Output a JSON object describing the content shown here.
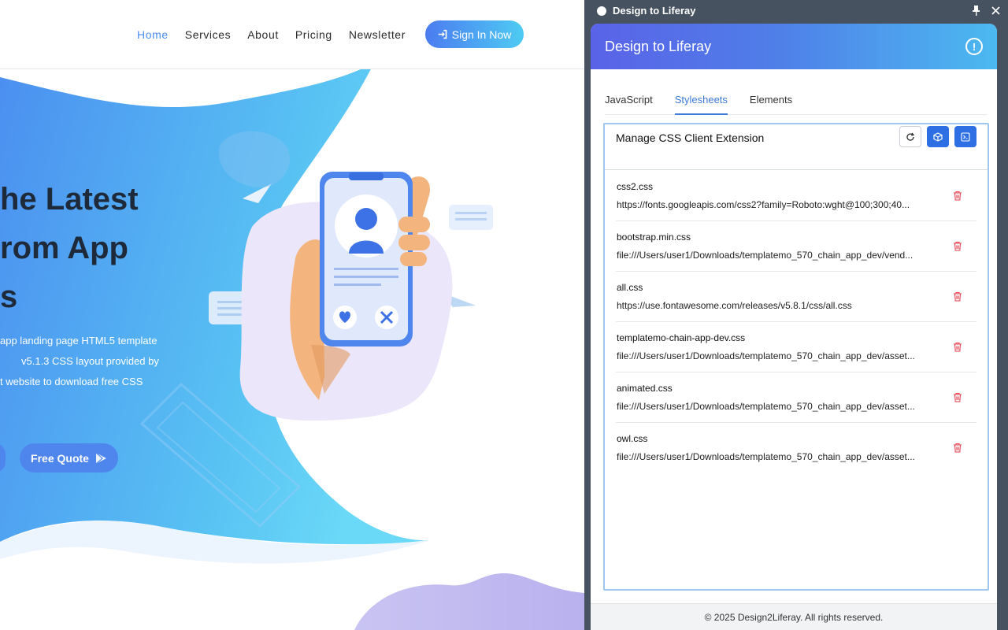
{
  "site": {
    "nav": [
      "Home",
      "Services",
      "About",
      "Pricing",
      "Newsletter"
    ],
    "active_nav": "Home",
    "signin_label": "Sign In Now",
    "hero_lines": [
      "he Latest",
      "rom App",
      "s"
    ],
    "hero_text_lines": [
      " app landing page HTML5 template",
      "v5.1.3 CSS layout provided by",
      "t website to download free CSS"
    ],
    "free_quote_label": "Free Quote"
  },
  "ext": {
    "window_title": "Design to Liferay",
    "header_title": "Design to Liferay",
    "tabs": [
      "JavaScript",
      "Stylesheets",
      "Elements"
    ],
    "active_tab": "Stylesheets",
    "section_title": "Manage CSS Client Extension",
    "files": [
      {
        "name": "css2.css",
        "url": "https://fonts.googleapis.com/css2?family=Roboto:wght@100;300;40..."
      },
      {
        "name": "bootstrap.min.css",
        "url": "file:///Users/user1/Downloads/templatemo_570_chain_app_dev/vend..."
      },
      {
        "name": "all.css",
        "url": "https://use.fontawesome.com/releases/v5.8.1/css/all.css"
      },
      {
        "name": "templatemo-chain-app-dev.css",
        "url": "file:///Users/user1/Downloads/templatemo_570_chain_app_dev/asset..."
      },
      {
        "name": "animated.css",
        "url": "file:///Users/user1/Downloads/templatemo_570_chain_app_dev/asset..."
      },
      {
        "name": "owl.css",
        "url": "file:///Users/user1/Downloads/templatemo_570_chain_app_dev/asset..."
      }
    ],
    "footer": "© 2025 Design2Liferay. All rights reserved.",
    "colors": {
      "accent": "#2f6fe4",
      "tab_active": "#3d7ad6",
      "delete": "#e0414a"
    },
    "icons": [
      "pin-icon",
      "close-icon",
      "info-icon",
      "refresh-icon",
      "cube-icon",
      "terminal-icon",
      "trash-icon"
    ]
  }
}
